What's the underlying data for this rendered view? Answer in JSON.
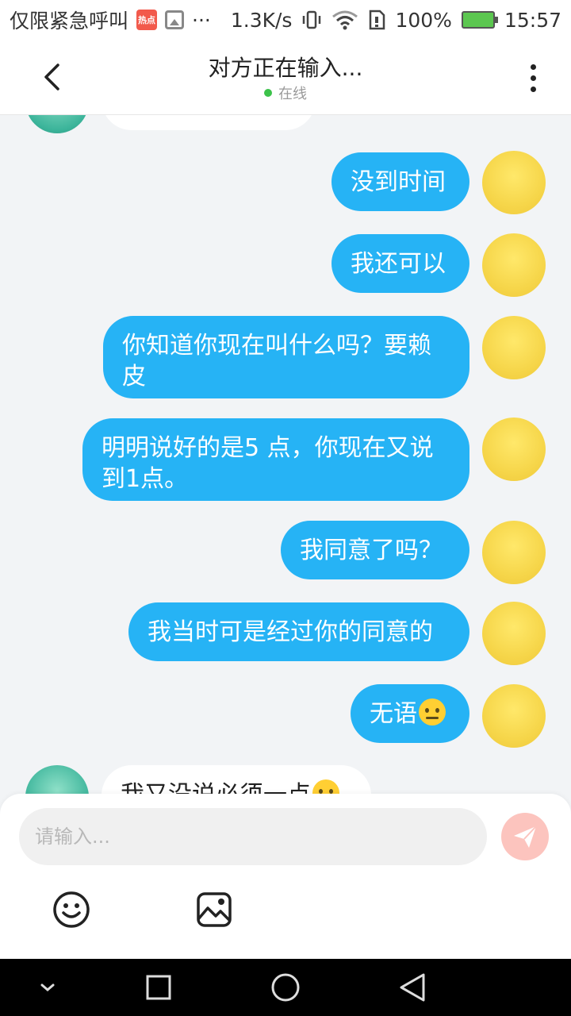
{
  "status_bar": {
    "left_text": "仅限紧急呼叫",
    "hot_label": "热点",
    "dots": "···",
    "net_speed": "1.3K/s",
    "battery": "100%",
    "time": "15:57"
  },
  "header": {
    "title": "对方正在输入...",
    "status": "在线"
  },
  "messages": [
    {
      "from": "me",
      "text": "没到时间"
    },
    {
      "from": "me",
      "text": "我还可以"
    },
    {
      "from": "me",
      "text": "你知道你现在叫什么吗？要赖皮"
    },
    {
      "from": "me",
      "text": "明明说好的是5 点，你现在又说到1点。"
    },
    {
      "from": "me",
      "text": "我同意了吗？"
    },
    {
      "from": "me",
      "text": "我当时可是经过你的同意的"
    },
    {
      "from": "me",
      "text": "无语",
      "emoji": "sweat-face-emoji"
    },
    {
      "from": "other",
      "text": "我又没说必须一点",
      "emoji": "smile-emoji"
    }
  ],
  "input": {
    "placeholder": "请输入..."
  },
  "icons": {
    "back": "chevron-left-icon",
    "more": "more-vertical-icon",
    "send": "send-icon",
    "emoji": "smiley-icon",
    "image": "image-icon"
  },
  "colors": {
    "bubble_out": "#26b3f5",
    "online": "#3cc24a",
    "send_button": "#fcc4be"
  }
}
